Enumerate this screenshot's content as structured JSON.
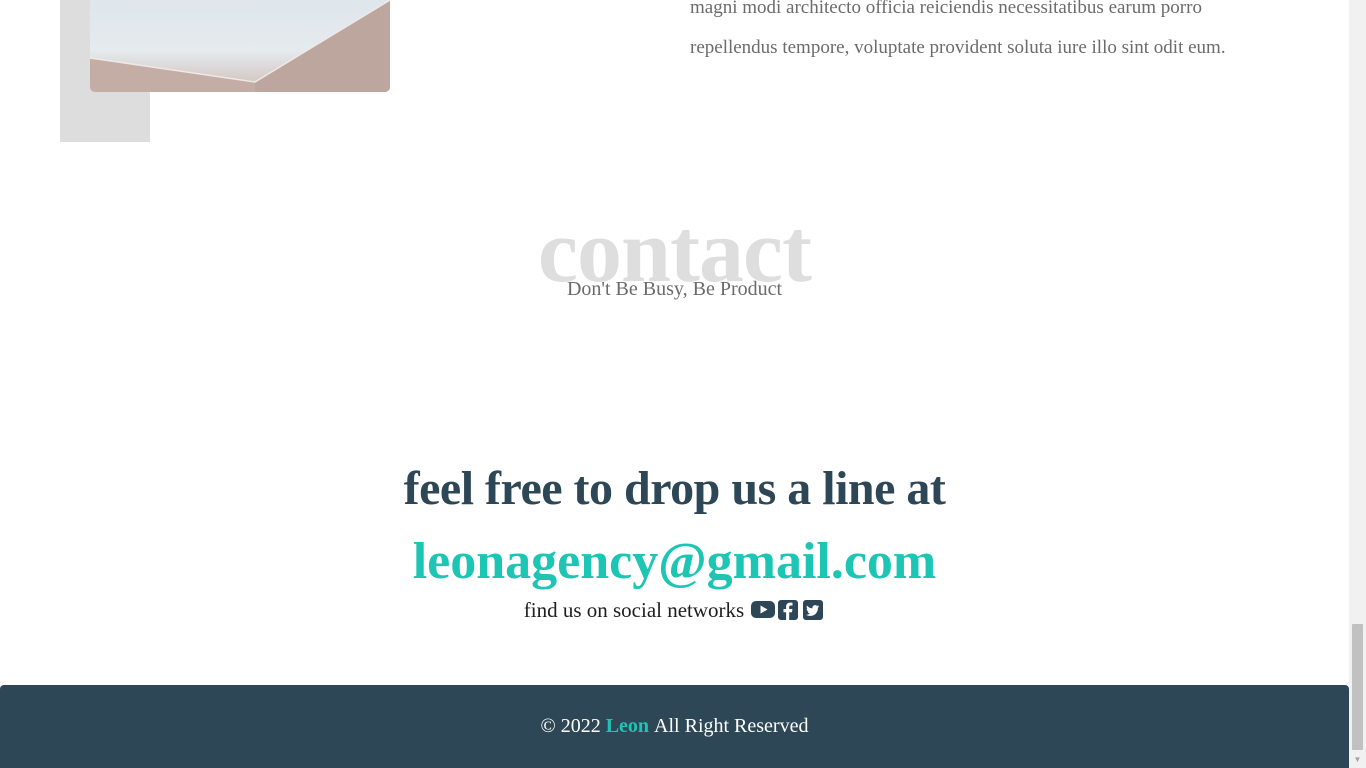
{
  "about": {
    "paragraph_lines": [
      "magni modi architecto officia reiciendis necessitatibus earum porro",
      "repellendus tempore, voluptate provident soluta iure illo sint odit eum."
    ]
  },
  "contact": {
    "title": "contact",
    "subtitle": "Don't Be Busy, Be Product",
    "line_heading": "feel free to drop us a line at",
    "email": "leonagency@gmail.com",
    "social_label": "find us on social networks",
    "social_icons": [
      "youtube-icon",
      "facebook-icon",
      "twitter-icon"
    ]
  },
  "footer": {
    "copyright": "© 2022",
    "brand": "Leon",
    "rights": "All Right Reserved"
  },
  "colors": {
    "accent": "#1dc6b4",
    "dark": "#2e4756",
    "muted_title": "#dedede",
    "body_text": "#6b6b6b"
  }
}
